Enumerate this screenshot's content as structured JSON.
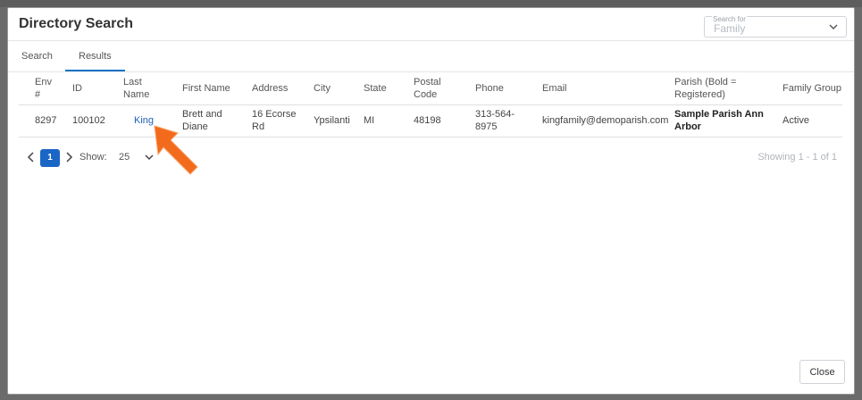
{
  "dialog": {
    "title": "Directory Search",
    "search_for": {
      "label": "Search for",
      "value": "Family"
    },
    "close_label": "Close"
  },
  "tabs": [
    {
      "label": "Search",
      "active": false
    },
    {
      "label": "Results",
      "active": true
    }
  ],
  "table": {
    "columns": [
      "Env #",
      "ID",
      "Last Name",
      "First Name",
      "Address",
      "City",
      "State",
      "Postal Code",
      "Phone",
      "Email",
      "Parish (Bold = Registered)",
      "Family Group"
    ],
    "rows": [
      {
        "env": "8297",
        "id": "100102",
        "last_name": "King",
        "first_name": "Brett and Diane",
        "address": "16 Ecorse Rd",
        "city": "Ypsilanti",
        "state": "MI",
        "postal_code": "48198",
        "phone": "313-564-8975",
        "email": "kingfamily@demoparish.com",
        "parish": "Sample Parish Ann Arbor",
        "family_group": "Active"
      }
    ]
  },
  "pager": {
    "current_page": "1",
    "show_label": "Show:",
    "page_size": "25",
    "showing_text": "Showing 1 - 1 of 1"
  },
  "colors": {
    "accent": "#1a66c5",
    "link": "#1c5fb5",
    "annotation_arrow": "#f26b1d"
  },
  "icons": {
    "dropdown": "chevron-down-icon",
    "prev": "chevron-left-icon",
    "next": "chevron-right-icon",
    "annotation": "pointer-arrow-icon"
  }
}
